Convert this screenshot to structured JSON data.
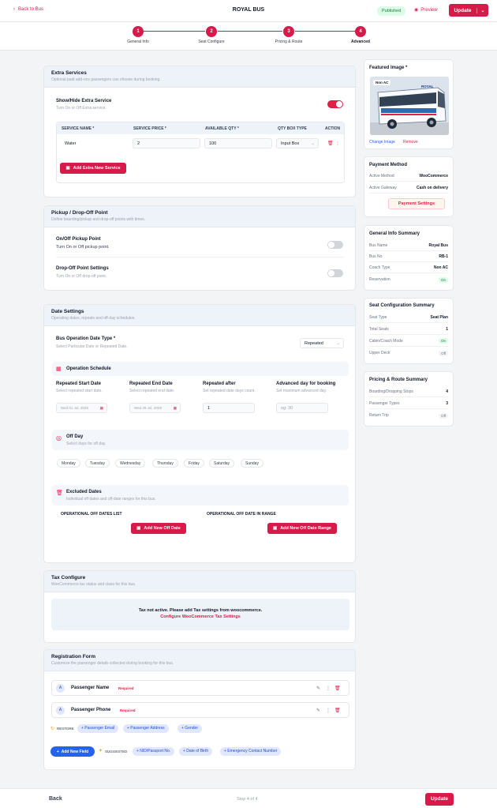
{
  "header": {
    "back_label": "Back to Bus",
    "title": "ROYAL BUS",
    "status": "Published",
    "preview_label": "Preview",
    "update_label": "Update"
  },
  "steps": [
    {
      "num": "1",
      "label": "General Info"
    },
    {
      "num": "2",
      "label": "Seat Configure"
    },
    {
      "num": "3",
      "label": "Pricing & Route"
    },
    {
      "num": "4",
      "label": "Advanced"
    }
  ],
  "extra_services": {
    "title": "Extra Services",
    "subtitle": "Optional paid add-ons passengers can choose during booking.",
    "toggle_label": "Show/Hide Extra Service",
    "toggle_sub": "Turn On or Off Extra service.",
    "columns": [
      "SERVICE NAME *",
      "SERVICE PRICE *",
      "AVAILABLE QTY *",
      "QTY BOX TYPE",
      "ACTION"
    ],
    "row": {
      "name": "Water",
      "price": "2",
      "qty": "100",
      "box_type": "Input Box"
    },
    "add_label": "Add Extra New Service"
  },
  "pickup": {
    "title": "Pickup / Drop-Off Point",
    "subtitle": "Define boarding/pickup and drop-off points with times.",
    "pickup_label": "On/Off Pickup Point",
    "pickup_sub": "Turn On or Off pickup point.",
    "drop_label": "Drop-Off Point Settings",
    "drop_sub": "Turn On or Off drop-off point."
  },
  "date_settings": {
    "title": "Date Settings",
    "subtitle": "Operating dates, repeats and off-day schedules.",
    "op_type_label": "Bus Operation Date Type *",
    "op_type_sub": "Select Particular Date or Repeated Date.",
    "op_type_value": "Repeated",
    "schedule_title": "Operation Schedule",
    "fields": [
      {
        "label": "Repeated Start Date",
        "sub": "Select repeated start date.",
        "value": "Wed 01 Jul, 2026"
      },
      {
        "label": "Repeated End Date",
        "sub": "Select repeated end date.",
        "value": "Wed 29 Jul, 2026"
      },
      {
        "label": "Repeated after",
        "sub": "Set repeated date days count.",
        "value": "1"
      },
      {
        "label": "Advanced day for booking",
        "sub": "Set maximum advanced day.",
        "value": "eg: 30"
      }
    ],
    "offday_title": "Off Day",
    "offday_sub": "Select days for off day.",
    "days": [
      "Monday",
      "Tuesday",
      "Wednesday",
      "Thursday",
      "Friday",
      "Saturday",
      "Sunday"
    ],
    "excluded_title": "Excluded Dates",
    "excluded_sub": "Individual off dates and off-date ranges for this bus.",
    "offlist_label": "OPERATIONAL OFF DATES LIST",
    "offrange_label": "OPERATIONAL OFF DATE IN RANGE",
    "add_off_date": "Add New Off Date",
    "add_off_range": "Add New Off Date Range"
  },
  "tax": {
    "title": "Tax Configure",
    "subtitle": "WooCommerce tax status and class for this bus.",
    "notice": "Tax not active. Please add Tax settings from woocommerce.",
    "link": "Configure WooCommerce Tax Settings"
  },
  "registration": {
    "title": "Registration Form",
    "subtitle": "Customize the passenger details collected during booking for this bus.",
    "fields": [
      {
        "label": "Passenger Name",
        "badge": "Required"
      },
      {
        "label": "Passenger Phone",
        "badge": "Required"
      }
    ],
    "restore_label": "RESTORE",
    "restore_items": [
      "+ Passenger Email",
      "+ Passenger Address",
      "+ Gender"
    ],
    "add_field": "Add New Field",
    "suggested_label": "SUGGESTED",
    "suggested_items": [
      "+ NID/Passport No.",
      "+ Date of Birth",
      "+ Emergency Contact Number"
    ]
  },
  "sidebar": {
    "featured": {
      "title": "Featured Image *",
      "badge": "Non AC",
      "bus_text": "ROYAL",
      "change": "Change Image",
      "remove": "Remove"
    },
    "payment": {
      "title": "Payment Method",
      "rows": [
        {
          "k": "Active Method",
          "v": "WooCommerce"
        },
        {
          "k": "Active Gateway",
          "v": "Cash on delivery"
        }
      ],
      "button": "Payment Settings"
    },
    "general": {
      "title": "General Info Summary",
      "rows": [
        {
          "k": "Bus Name",
          "v": "Royal Bus"
        },
        {
          "k": "Bus No",
          "v": "RB-1"
        },
        {
          "k": "Coach Type",
          "v": "Non AC"
        },
        {
          "k": "Reservation",
          "v": "On"
        }
      ]
    },
    "seat": {
      "title": "Seat Configuration Summary",
      "rows": [
        {
          "k": "Seat Type",
          "v": "Seat Plan"
        },
        {
          "k": "Total Seats",
          "v": "1"
        },
        {
          "k": "Cabin/Coach Mode",
          "v": "On"
        },
        {
          "k": "Upper Deck",
          "v": "Off"
        }
      ]
    },
    "pricing": {
      "title": "Pricing & Route Summary",
      "rows": [
        {
          "k": "Boarding/Dropping Stops",
          "v": "4"
        },
        {
          "k": "Passenger Types",
          "v": "3"
        },
        {
          "k": "Return Trip",
          "v": "Off"
        }
      ]
    }
  },
  "footer": {
    "back": "Back",
    "step": "Step 4 of 4",
    "update": "Update"
  },
  "colors": {
    "accent": "#d61a49",
    "published_bg": "#dcfce7",
    "link_blue": "#2563eb"
  }
}
